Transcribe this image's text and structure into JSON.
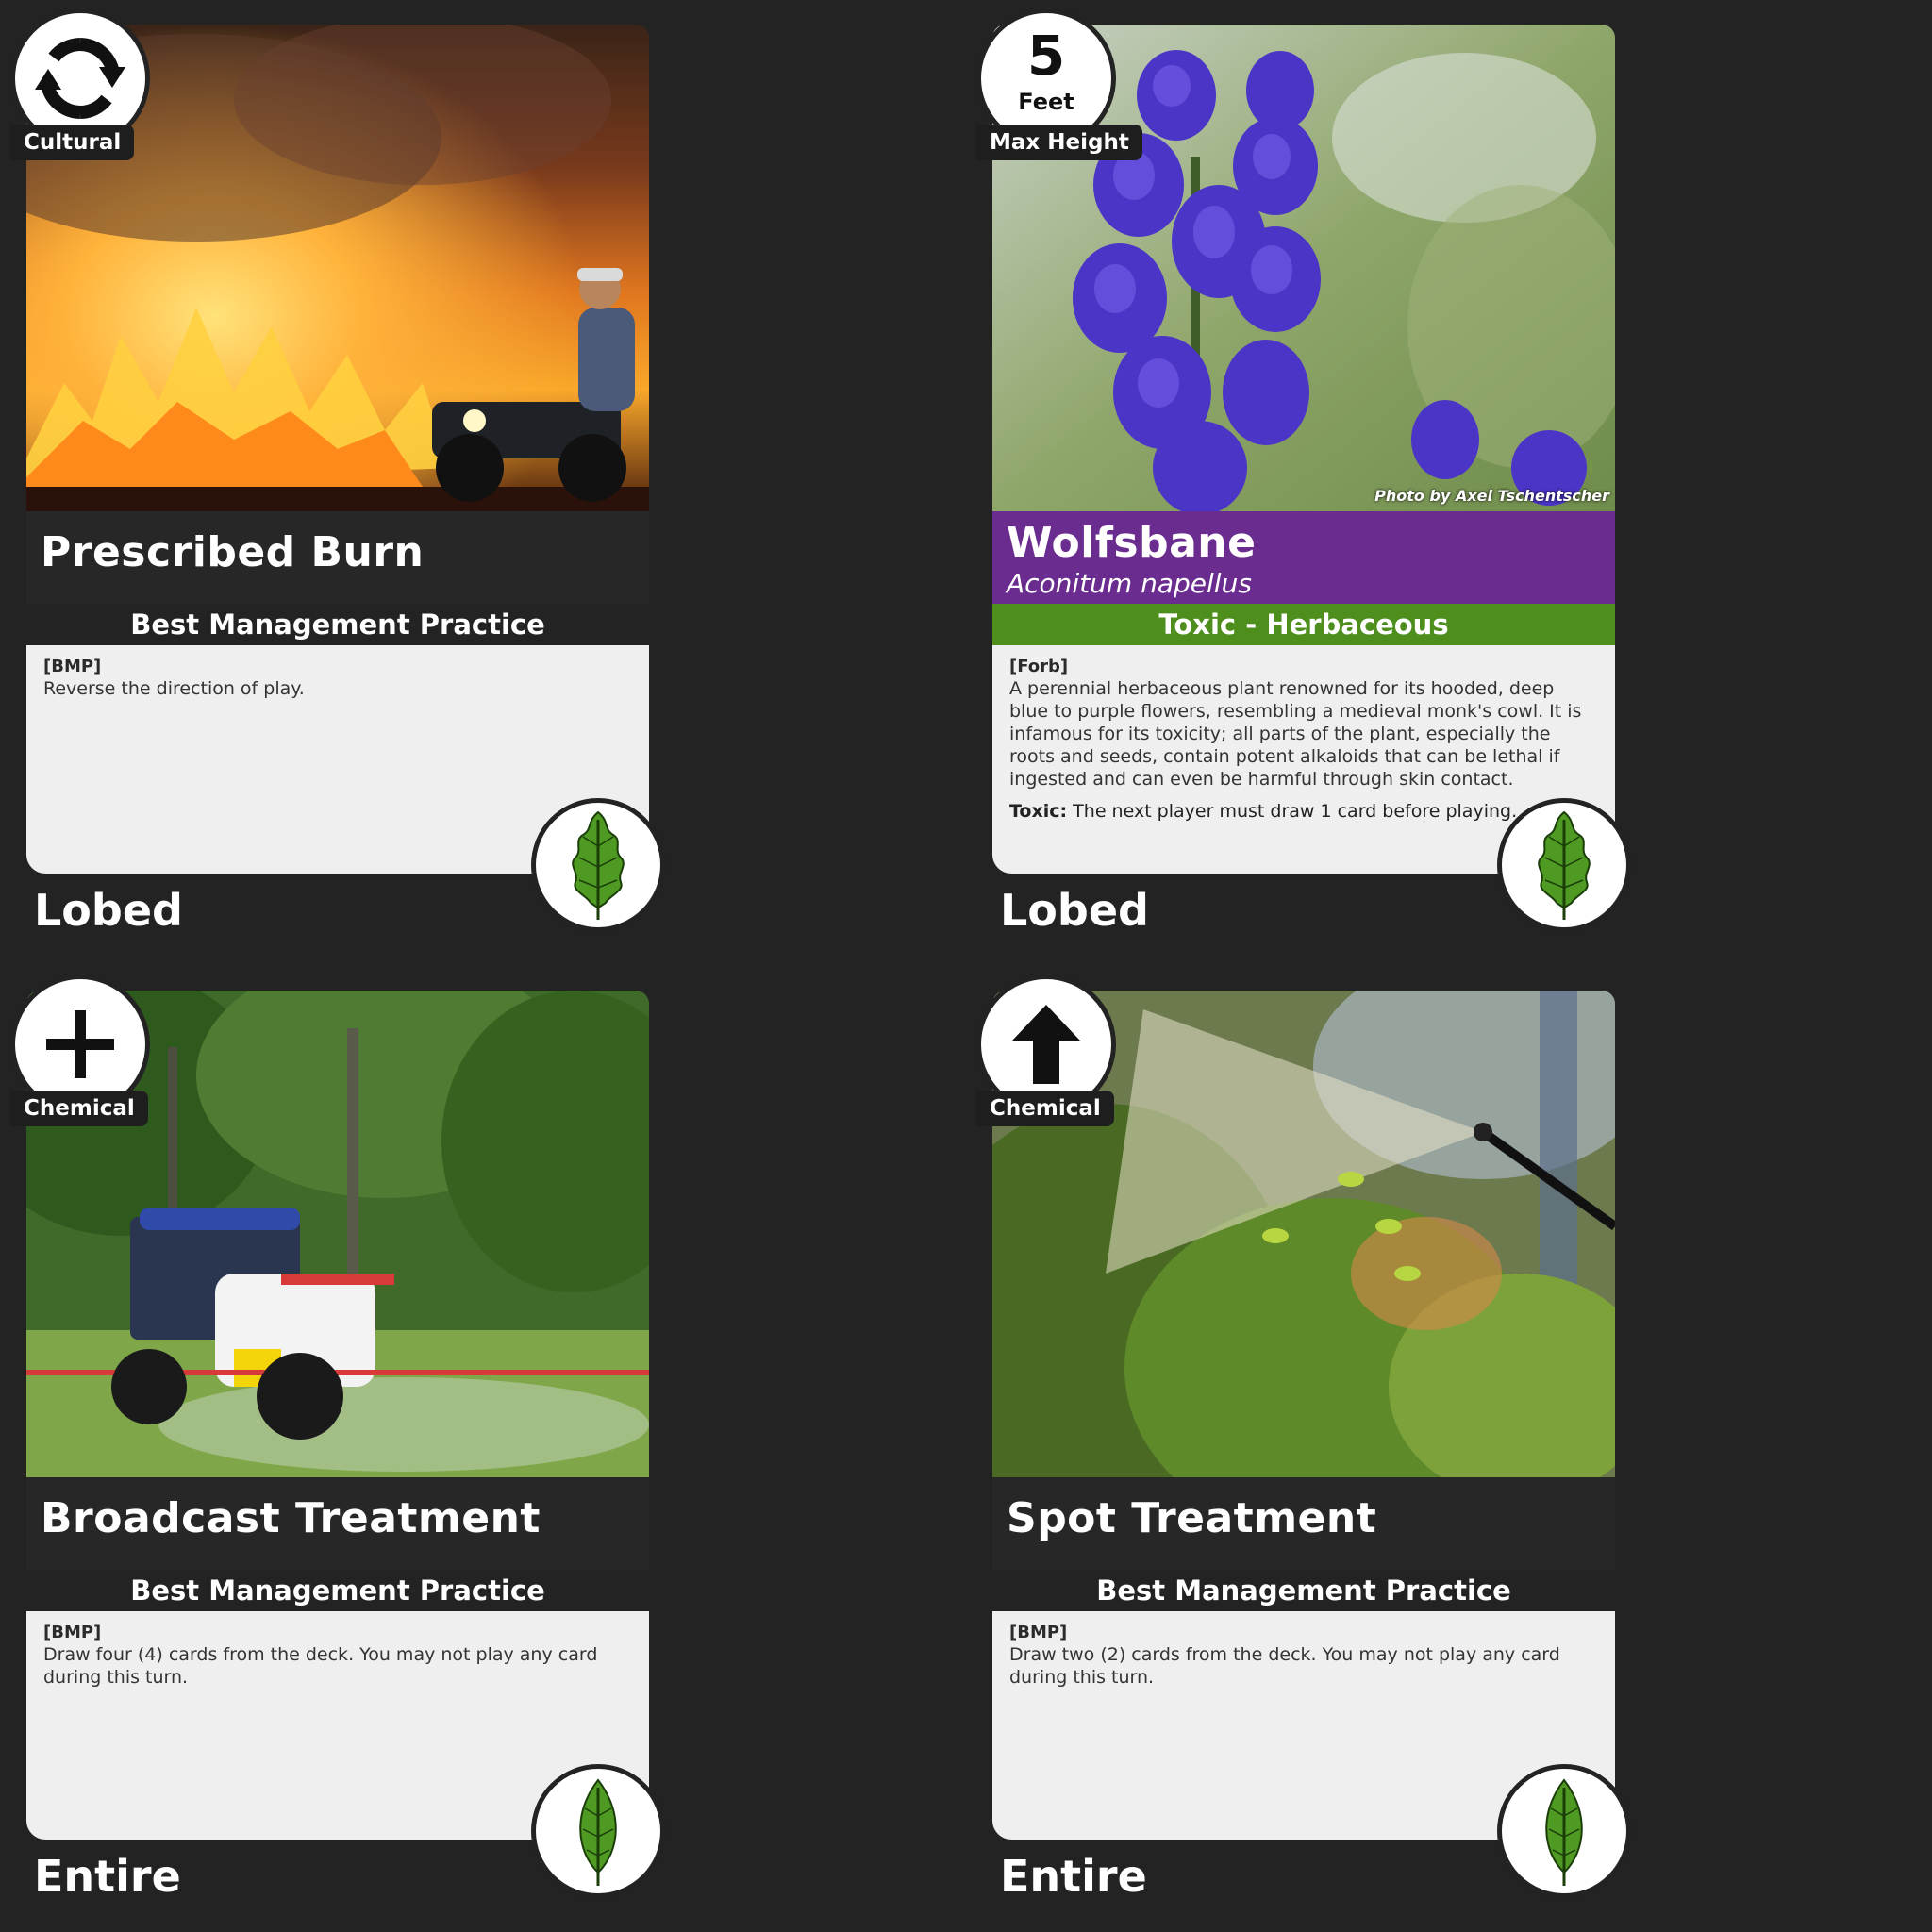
{
  "colors": {
    "background": "#232323",
    "bmp_text_box": "#efefef",
    "toxic_bar": "#4e8e1c",
    "plant_title_bar": "#6b2c90",
    "leaf_green": "#4f9a22"
  },
  "cards": [
    {
      "kind": "bmp",
      "badge_icon": "rotate-arrows-icon",
      "badge_label": "Cultural",
      "title": "Prescribed Burn",
      "subtitle": "Best Management Practice",
      "tag": "[BMP]",
      "description": "Reverse the direction of play.",
      "leaf_icon": "lobed-leaf-icon",
      "leaf_shape": "Lobed"
    },
    {
      "kind": "plant",
      "badge_number": "5",
      "badge_unit": "Feet",
      "badge_label": "Max Height",
      "photo_credit": "Photo by Axel Tschentscher",
      "title": "Wolfsbane",
      "scientific_name": "Aconitum napellus",
      "subtitle": "Toxic - Herbaceous",
      "tag": "[Forb]",
      "description": "A perennial herbaceous plant renowned for its hooded, deep blue to purple flowers, resembling a medieval monk's cowl. It is infamous for its toxicity; all parts of the plant, especially the roots and seeds, contain potent alkaloids that can be lethal if ingested and can even be harmful through skin contact.",
      "effect_label": "Toxic:",
      "effect_text": "The next player must draw 1 card before playing.",
      "leaf_icon": "lobed-leaf-icon",
      "leaf_shape": "Lobed"
    },
    {
      "kind": "bmp",
      "badge_icon": "plus-icon",
      "badge_label": "Chemical",
      "title": "Broadcast Treatment",
      "subtitle": "Best Management Practice",
      "tag": "[BMP]",
      "description": "Draw four (4) cards from the deck. You may not play any card during this turn.",
      "leaf_icon": "entire-leaf-icon",
      "leaf_shape": "Entire"
    },
    {
      "kind": "bmp",
      "badge_icon": "up-arrow-icon",
      "badge_label": "Chemical",
      "title": "Spot Treatment",
      "subtitle": "Best Management Practice",
      "tag": "[BMP]",
      "description": "Draw two (2) cards from the deck. You may not play any card during this turn.",
      "leaf_icon": "entire-leaf-icon",
      "leaf_shape": "Entire"
    }
  ]
}
